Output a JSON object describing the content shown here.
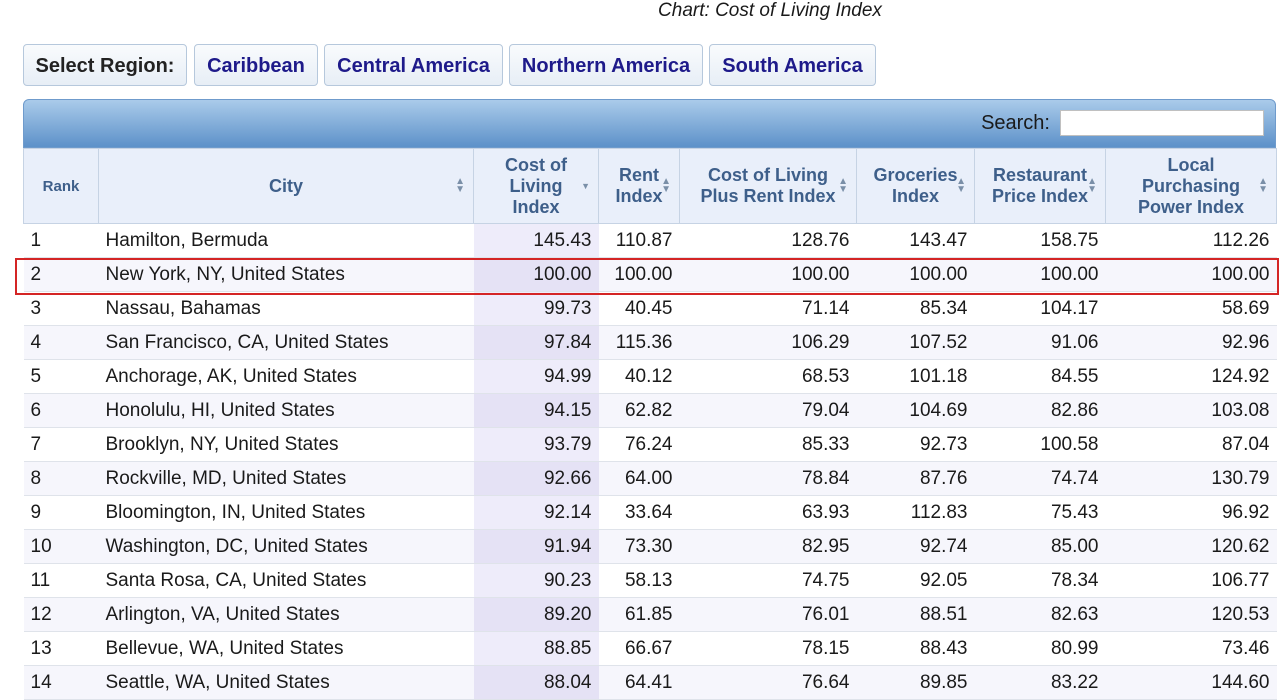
{
  "chart_link": "Chart: Cost of Living Index",
  "region": {
    "label": "Select Region:",
    "buttons": [
      "Caribbean",
      "Central America",
      "Northern America",
      "South America"
    ]
  },
  "search": {
    "label": "Search:",
    "value": ""
  },
  "columns": [
    [
      "Rank"
    ],
    [
      "City"
    ],
    [
      "Cost of",
      "Living",
      "Index"
    ],
    [
      "Rent",
      "Index"
    ],
    [
      "Cost of Living",
      "Plus Rent Index"
    ],
    [
      "Groceries",
      "Index"
    ],
    [
      "Restaurant",
      "Price Index"
    ],
    [
      "Local",
      "Purchasing",
      "Power Index"
    ]
  ],
  "sorted_column": 2,
  "rows": [
    [
      "1",
      "Hamilton, Bermuda",
      "145.43",
      "110.87",
      "128.76",
      "143.47",
      "158.75",
      "112.26"
    ],
    [
      "2",
      "New York, NY, United States",
      "100.00",
      "100.00",
      "100.00",
      "100.00",
      "100.00",
      "100.00"
    ],
    [
      "3",
      "Nassau, Bahamas",
      "99.73",
      "40.45",
      "71.14",
      "85.34",
      "104.17",
      "58.69"
    ],
    [
      "4",
      "San Francisco, CA, United States",
      "97.84",
      "115.36",
      "106.29",
      "107.52",
      "91.06",
      "92.96"
    ],
    [
      "5",
      "Anchorage, AK, United States",
      "94.99",
      "40.12",
      "68.53",
      "101.18",
      "84.55",
      "124.92"
    ],
    [
      "6",
      "Honolulu, HI, United States",
      "94.15",
      "62.82",
      "79.04",
      "104.69",
      "82.86",
      "103.08"
    ],
    [
      "7",
      "Brooklyn, NY, United States",
      "93.79",
      "76.24",
      "85.33",
      "92.73",
      "100.58",
      "87.04"
    ],
    [
      "8",
      "Rockville, MD, United States",
      "92.66",
      "64.00",
      "78.84",
      "87.76",
      "74.74",
      "130.79"
    ],
    [
      "9",
      "Bloomington, IN, United States",
      "92.14",
      "33.64",
      "63.93",
      "112.83",
      "75.43",
      "96.92"
    ],
    [
      "10",
      "Washington, DC, United States",
      "91.94",
      "73.30",
      "82.95",
      "92.74",
      "85.00",
      "120.62"
    ],
    [
      "11",
      "Santa Rosa, CA, United States",
      "90.23",
      "58.13",
      "74.75",
      "92.05",
      "78.34",
      "106.77"
    ],
    [
      "12",
      "Arlington, VA, United States",
      "89.20",
      "61.85",
      "76.01",
      "88.51",
      "82.63",
      "120.53"
    ],
    [
      "13",
      "Bellevue, WA, United States",
      "88.85",
      "66.67",
      "78.15",
      "88.43",
      "80.99",
      "73.46"
    ],
    [
      "14",
      "Seattle, WA, United States",
      "88.04",
      "64.41",
      "76.64",
      "89.85",
      "83.22",
      "144.60"
    ]
  ],
  "highlighted_row": 2,
  "colors": {
    "highlight_border": "#d42525",
    "region_link": "#1e1a8a",
    "header_text": "#3e5f8a"
  }
}
